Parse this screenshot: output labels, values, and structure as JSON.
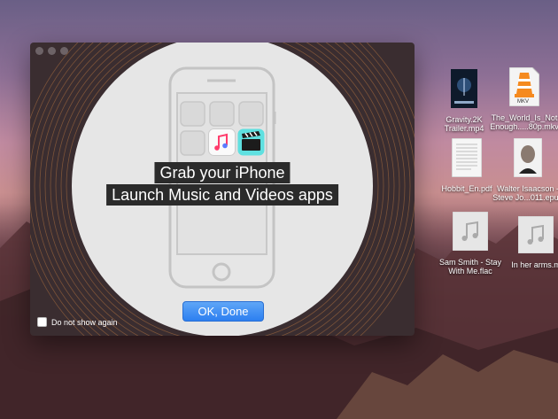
{
  "dialog": {
    "heading_line1": "Grab your iPhone",
    "heading_line2": "Launch Music and Videos apps",
    "ok_button": "OK, Done",
    "checkbox_label": "Do not show again",
    "checkbox_checked": false
  },
  "desktop_files": [
    {
      "line1": "Gravity.2K",
      "line2": "Trailer.mp4",
      "icon": "movie-file-icon"
    },
    {
      "line1": "The_World_Is_Not",
      "line2": "Enough.....80p.mkv",
      "icon": "vlc-mkv-file-icon",
      "badge": "MKV"
    },
    {
      "line1": "Hobbit_En.pdf",
      "line2": "",
      "icon": "pdf-file-icon"
    },
    {
      "line1": "Walter Isaacson -",
      "line2": "Steve Jo...011.epub",
      "icon": "epub-file-icon"
    },
    {
      "line1": "Sam Smith - Stay",
      "line2": "With Me.flac",
      "icon": "music-file-icon"
    },
    {
      "line1": "In her arms.m",
      "line2": "",
      "icon": "music-file-icon"
    }
  ]
}
